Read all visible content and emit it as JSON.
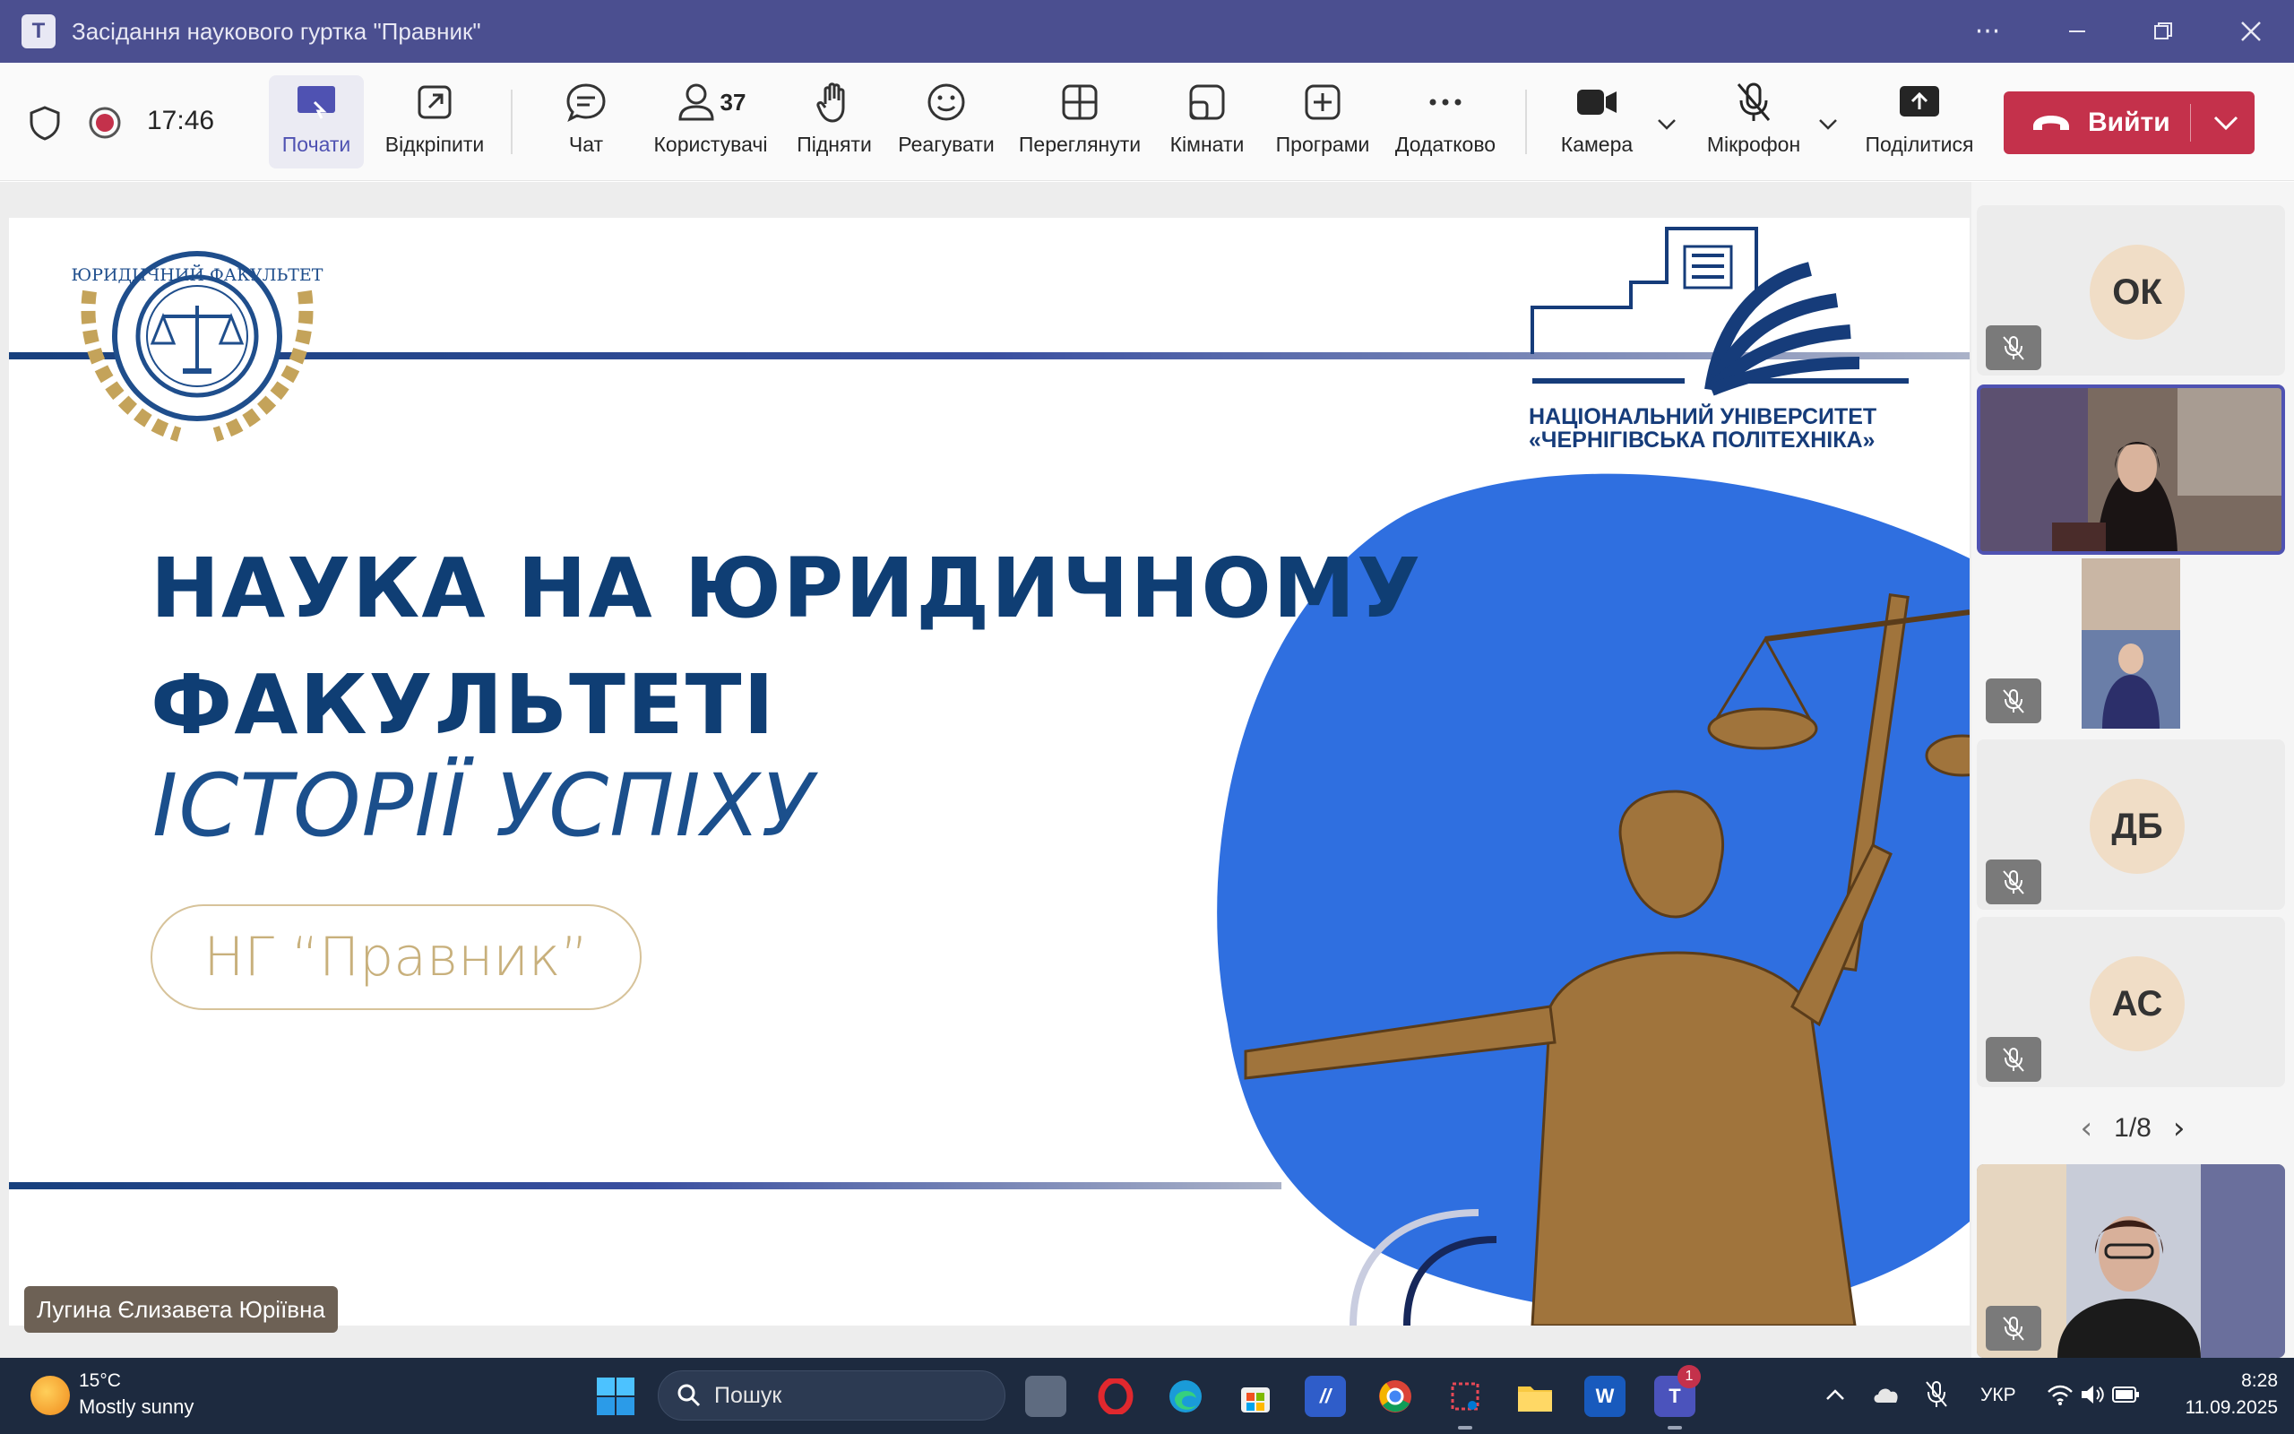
{
  "window": {
    "title": "Засідання наукового гуртка \"Правник\"",
    "app_icon": "teams-icon"
  },
  "toolbar": {
    "time": "17:46",
    "items": {
      "present": "Почати",
      "popout": "Відкріпити",
      "chat": "Чат",
      "people": "Користувачі",
      "people_count": "37",
      "raise": "Підняти",
      "react": "Реагувати",
      "view": "Переглянути",
      "rooms": "Кімнати",
      "apps": "Програми",
      "more": "Додатково",
      "camera": "Камера",
      "mic": "Мікрофон",
      "share": "Поділитися"
    },
    "leave_label": "Вийти",
    "colors": {
      "leave": "#c4314b",
      "accent": "#4f52b2",
      "recording": "#c4314b"
    }
  },
  "slide": {
    "title_line1": "НАУКА НА ЮРИДИЧНОМУ",
    "title_line2": "ФАКУЛЬТЕТІ",
    "subtitle": "ІСТОРІЇ УСПІХУ",
    "pill_text": "НГ “Правник”",
    "seal_text": "ЮРИДИЧНИЙ ФАКУЛЬТЕТ",
    "university_line1": "НАЦІОНАЛЬНИЙ УНІВЕРСИТЕТ",
    "university_line2": "«ЧЕРНІГІВСЬКА ПОЛІТЕХНІКА»",
    "colors": {
      "title": "#0f3e74",
      "blob": "#2f6fe0",
      "gold": "#c8b07c"
    }
  },
  "speaker_name": "Лугина Єлизавета Юріївна",
  "gallery": {
    "tiles": [
      {
        "initials": "ОК",
        "muted": true
      },
      {
        "initials": "",
        "muted": false,
        "video": true,
        "selected": true
      },
      {
        "initials": "",
        "muted": true,
        "video": true
      },
      {
        "initials": "ДБ",
        "muted": true
      },
      {
        "initials": "АС",
        "muted": true
      },
      {
        "initials": "",
        "muted": true,
        "video": true
      }
    ],
    "page": "1/8"
  },
  "taskbar": {
    "weather_temp": "15°C",
    "weather_desc": "Mostly sunny",
    "search_placeholder": "Пошук",
    "teams_badge": "1",
    "language": "УКР",
    "time": "8:28",
    "date": "11.09.2025"
  }
}
